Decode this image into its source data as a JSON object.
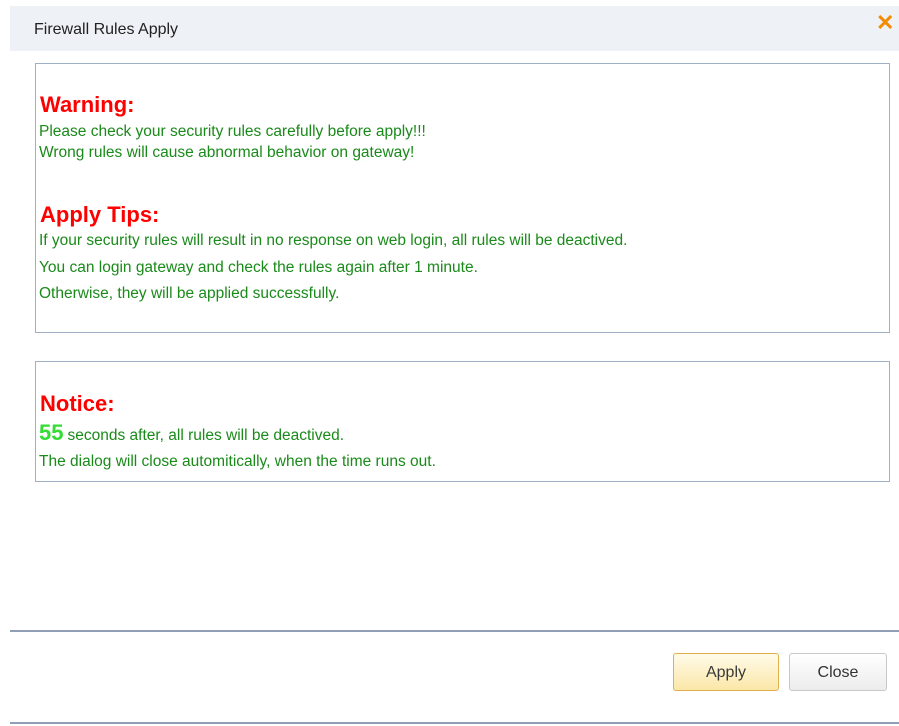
{
  "dialog": {
    "title": "Firewall Rules Apply",
    "close_icon": "close-icon",
    "accent_color": "#f28b00"
  },
  "warning": {
    "heading": "Warning:",
    "lines": [
      "Please check your security rules carefully before apply!!!",
      "Wrong rules will cause abnormal behavior on gateway!"
    ]
  },
  "tips": {
    "heading": "Apply Tips:",
    "lines": [
      "If your security rules will result in no response on web login, all rules will be deactived.",
      "You can login gateway and check the rules again after 1 minute.",
      "Otherwise, they will be applied successfully."
    ]
  },
  "notice": {
    "heading": "Notice:",
    "countdown": "55",
    "countdown_suffix": "seconds after, all rules will be deactived.",
    "line2": "The dialog will close automitically, when the time runs out."
  },
  "buttons": {
    "apply": "Apply",
    "close": "Close"
  },
  "colors": {
    "heading": "#ff0000",
    "body_text": "#1a8a1a",
    "countdown": "#33dd33"
  }
}
